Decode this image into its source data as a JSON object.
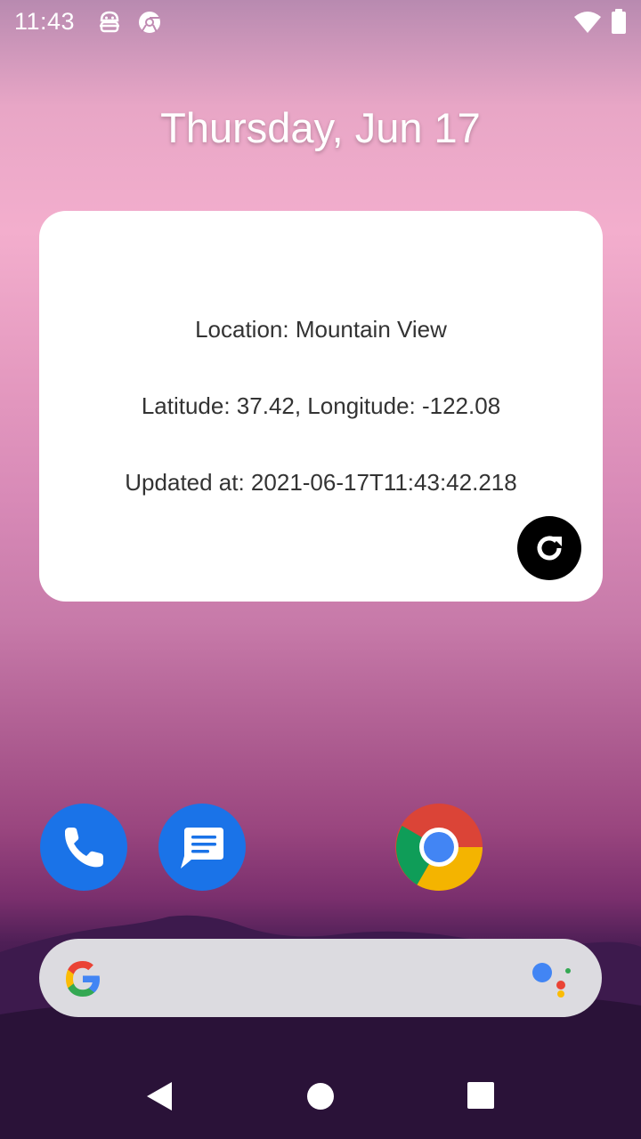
{
  "status_bar": {
    "time": "11:43",
    "icons": [
      "android-debug-icon",
      "chrome-notification-icon",
      "wifi-icon",
      "battery-icon"
    ]
  },
  "home": {
    "date": "Thursday, Jun 17"
  },
  "widget": {
    "location": "Location: Mountain View",
    "coordinates": "Latitude: 37.42, Longitude: -122.08",
    "updated": "Updated at: 2021-06-17T11:43:42.218",
    "refresh_icon": "refresh-icon"
  },
  "dock": {
    "apps": [
      "phone-icon",
      "messages-icon",
      "chrome-icon"
    ]
  },
  "search": {
    "logo": "google-g-logo",
    "assistant": "google-assistant-icon"
  },
  "nav": {
    "buttons": [
      "back-icon",
      "home-icon",
      "recents-icon"
    ]
  },
  "colors": {
    "widget_bg": "#ffffff",
    "phone_blue": "#1a73e8",
    "search_bg": "#dcdbe0"
  }
}
